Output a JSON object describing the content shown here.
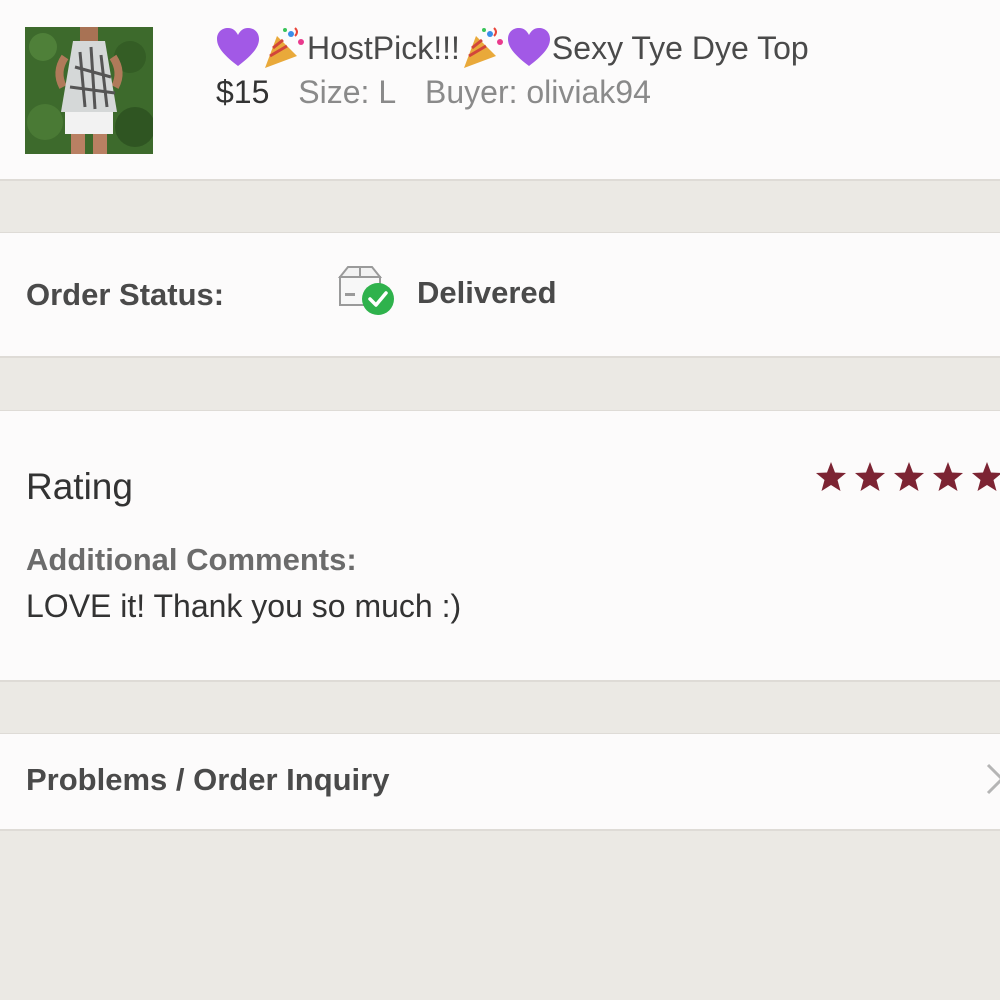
{
  "item": {
    "title": "HostPick!!!",
    "title_suffix": "Sexy Tye Dye Top",
    "price": "$15",
    "size": "Size: L",
    "buyer": "Buyer: oliviak94",
    "icons": [
      "purple-heart-emoji",
      "party-popper-emoji"
    ]
  },
  "order_status": {
    "label": "Order Status:",
    "value": "Delivered",
    "icon": "package-delivered-icon",
    "check_color": "#2fb24c"
  },
  "rating": {
    "label": "Rating",
    "stars": 5,
    "star_color": "#7c2433",
    "comments_label": "Additional Comments:",
    "comments": "LOVE it! Thank you so much :)"
  },
  "problems": {
    "label": "Problems / Order Inquiry",
    "icon": "chevron-right-icon"
  }
}
